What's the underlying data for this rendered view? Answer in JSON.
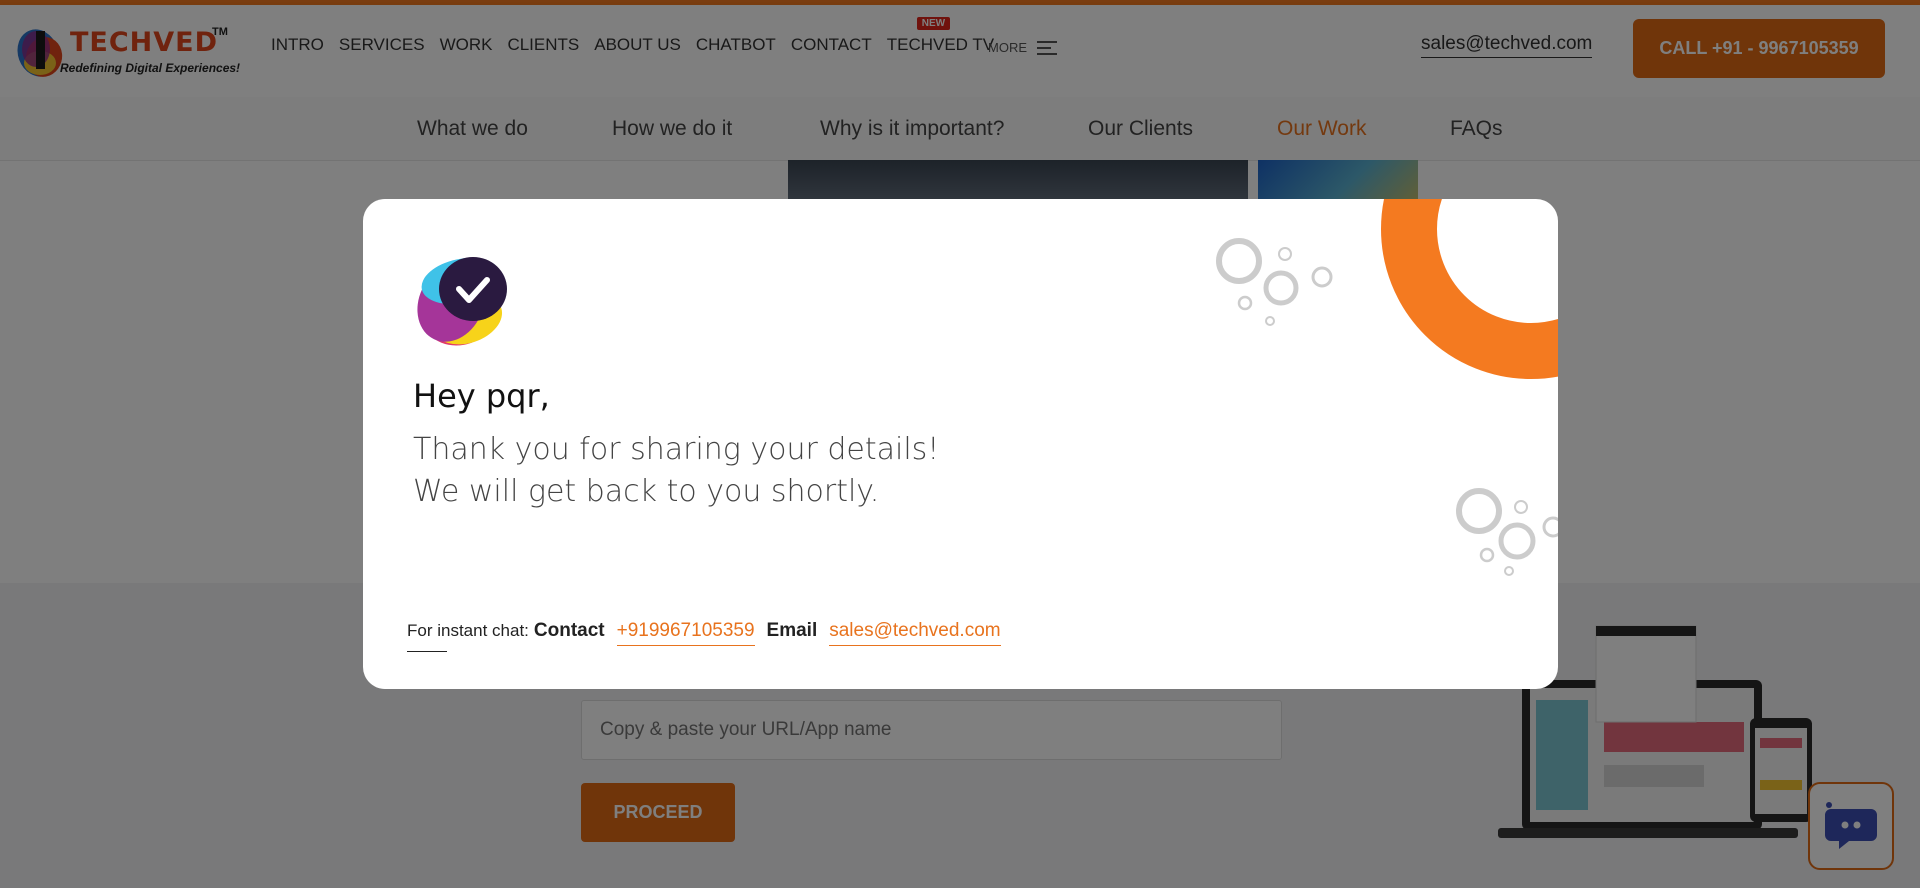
{
  "header": {
    "logo_text": "TECHVED",
    "logo_tm": "TM",
    "logo_tagline": "Redefining Digital Experiences!",
    "nav": [
      "INTRO",
      "SERVICES",
      "WORK",
      "CLIENTS",
      "ABOUT US",
      "CHATBOT",
      "CONTACT",
      "TECHVED TV"
    ],
    "new_badge": "NEW",
    "more_label": "MORE",
    "email": "sales@techved.com",
    "call_label": "CALL +91 - 9967105359"
  },
  "subnav": {
    "items": [
      "What we do",
      "How we do it",
      "Why is it important?",
      "Our Clients",
      "Our Work",
      "FAQs"
    ],
    "active": "Our Work"
  },
  "page": {
    "url_placeholder": "Copy & paste your URL/App name",
    "proceed_label": "PROCEED"
  },
  "modal": {
    "greeting": "Hey pqr,",
    "line1": "Thank you for sharing your details!",
    "line2": "We will get back to you shortly.",
    "instant_chat_label": "For instant chat:",
    "contact_label": "Contact",
    "phone": "+919967105359",
    "email_label": "Email",
    "email": "sales@techved.com"
  },
  "colors": {
    "brand_orange": "#e06a14",
    "accent_orange": "#e8731e",
    "overlay": "rgba(0,0,0,0.5)"
  }
}
